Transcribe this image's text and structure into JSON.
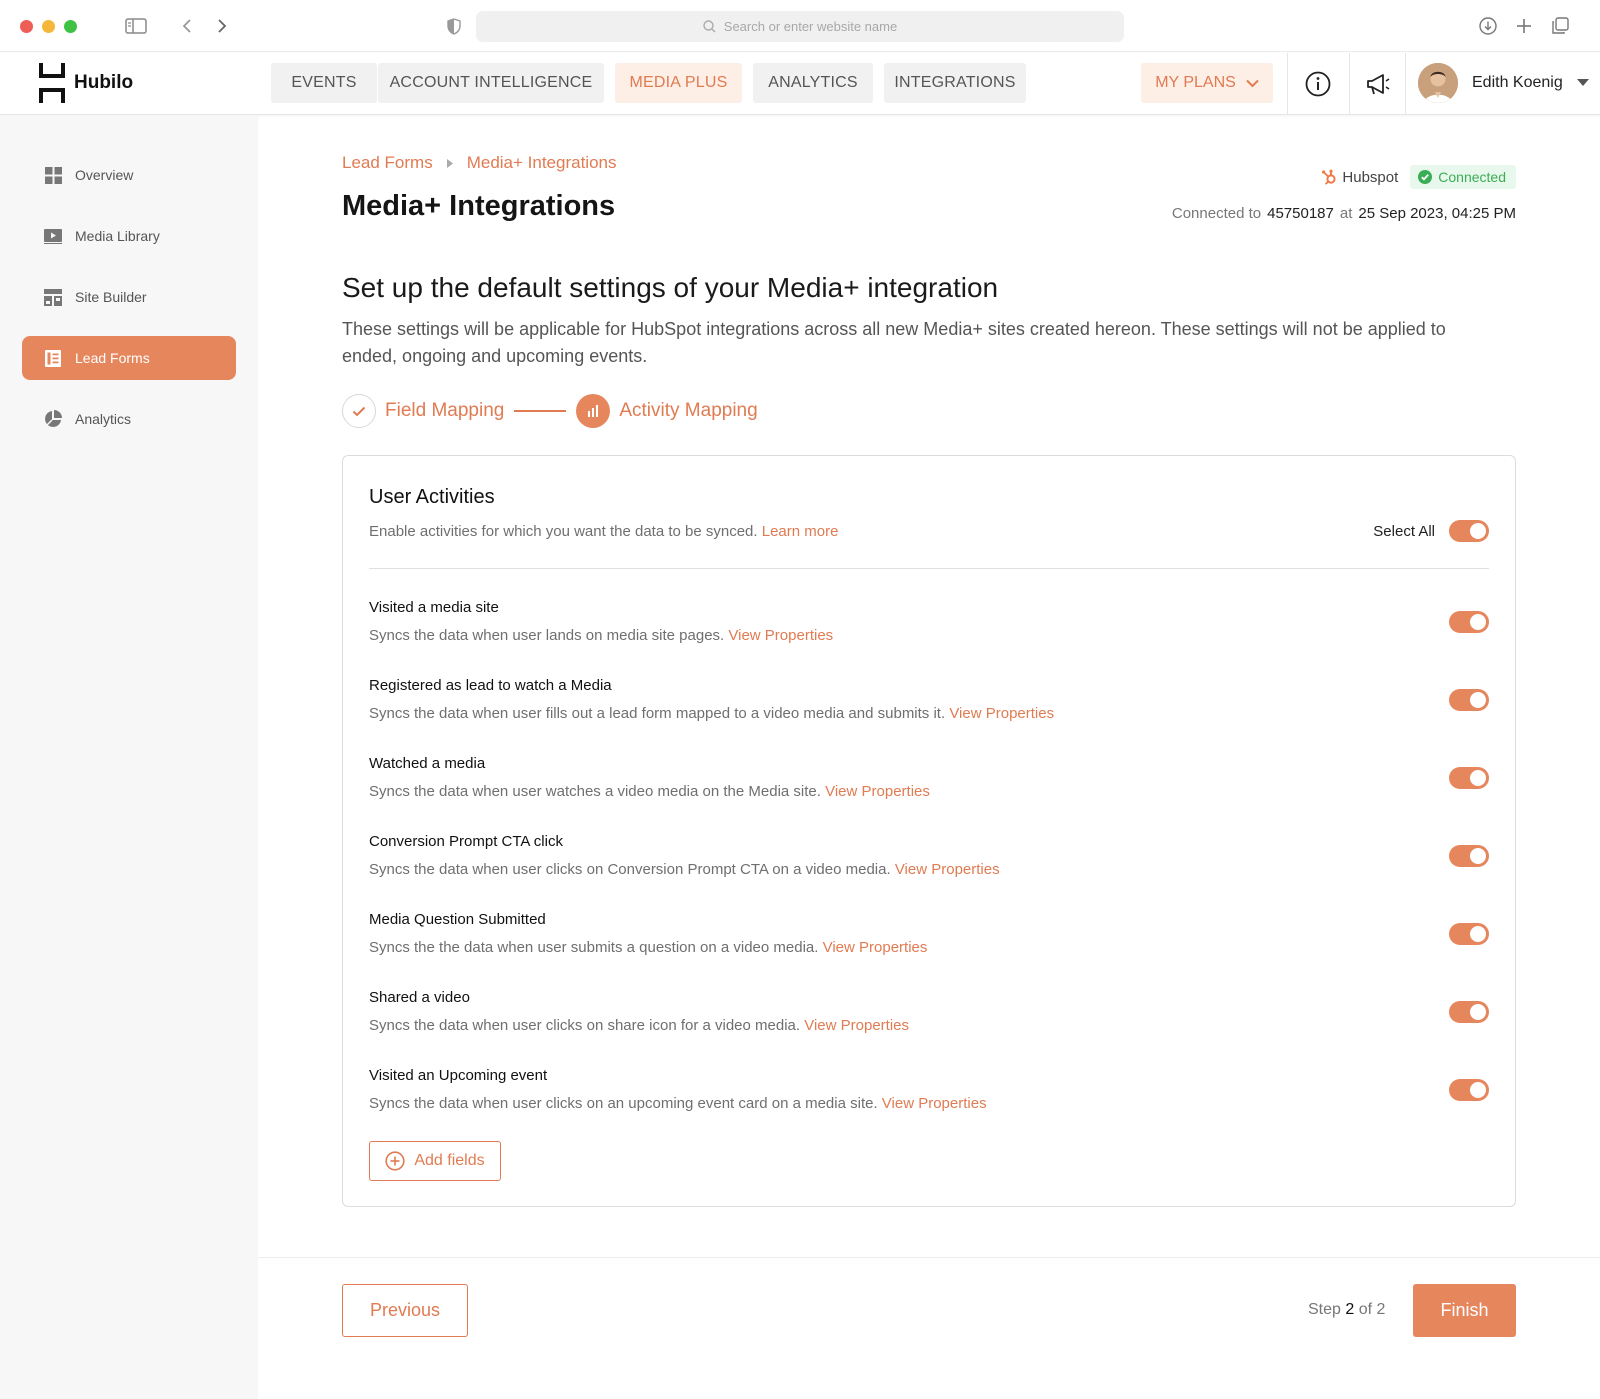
{
  "browser": {
    "url_placeholder": "Search or enter website name"
  },
  "header": {
    "brand": "Hubilo",
    "nav": [
      "EVENTS",
      "ACCOUNT INTELLIGENCE",
      "MEDIA PLUS",
      "ANALYTICS",
      "INTEGRATIONS"
    ],
    "active_nav": "MEDIA PLUS",
    "plans_label": "MY PLANS",
    "user_name": "Edith Koenig"
  },
  "sidebar": {
    "items": [
      {
        "label": "Overview",
        "icon": "grid-icon"
      },
      {
        "label": "Media Library",
        "icon": "play-icon"
      },
      {
        "label": "Site Builder",
        "icon": "layout-icon"
      },
      {
        "label": "Lead Forms",
        "icon": "form-icon",
        "active": true
      },
      {
        "label": "Analytics",
        "icon": "pie-chart-icon"
      }
    ]
  },
  "breadcrumb": [
    "Lead Forms",
    "Media+ Integrations"
  ],
  "page_title": "Media+ Integrations",
  "connection": {
    "provider": "Hubspot",
    "status": "Connected",
    "connected_to_label": "Connected to",
    "account_id": "45750187",
    "at_label": "at",
    "datetime": "25 Sep 2023, 04:25 PM"
  },
  "section": {
    "title": "Set up the default settings of your Media+ integration",
    "description": "These settings will be applicable for HubSpot integrations across all new Media+ sites created hereon.  These settings will not be applied to ended, ongoing and upcoming events."
  },
  "stepper": {
    "steps": [
      "Field Mapping",
      "Activity Mapping"
    ],
    "current": 2
  },
  "card": {
    "title": "User Activities",
    "subtitle": "Enable activities for which you want the data to be synced.",
    "learn_more": "Learn more",
    "select_all_label": "Select All",
    "select_all_on": true,
    "view_properties_label": "View Properties",
    "activities": [
      {
        "title": "Visited a media site",
        "desc": "Syncs the data when user lands on media site pages.",
        "enabled": true
      },
      {
        "title": "Registered as lead to watch a Media",
        "desc": "Syncs the data when user fills out a lead form mapped to a video media and submits it.",
        "enabled": true
      },
      {
        "title": "Watched a media",
        "desc": "Syncs the data when user watches a video media on the Media site.",
        "enabled": true
      },
      {
        "title": "Conversion Prompt CTA click",
        "desc": "Syncs the data when user clicks on Conversion Prompt CTA on a video media.",
        "enabled": true
      },
      {
        "title": "Media Question Submitted",
        "desc": "Syncs the the data when user submits a question on a video media.",
        "enabled": true
      },
      {
        "title": "Shared a video",
        "desc": "Syncs the data when user clicks on share icon for a video media.",
        "enabled": true
      },
      {
        "title": "Visited an Upcoming event",
        "desc": "Syncs the data when user clicks on an upcoming event card on a media site.",
        "enabled": true
      }
    ],
    "add_fields_label": "Add fields"
  },
  "footer": {
    "previous_label": "Previous",
    "step_prefix": "Step",
    "step_current": "2",
    "step_suffix": "of 2",
    "finish_label": "Finish"
  },
  "colors": {
    "accent": "#e6865d",
    "accent_text": "#e07b52",
    "success": "#3aae56"
  }
}
